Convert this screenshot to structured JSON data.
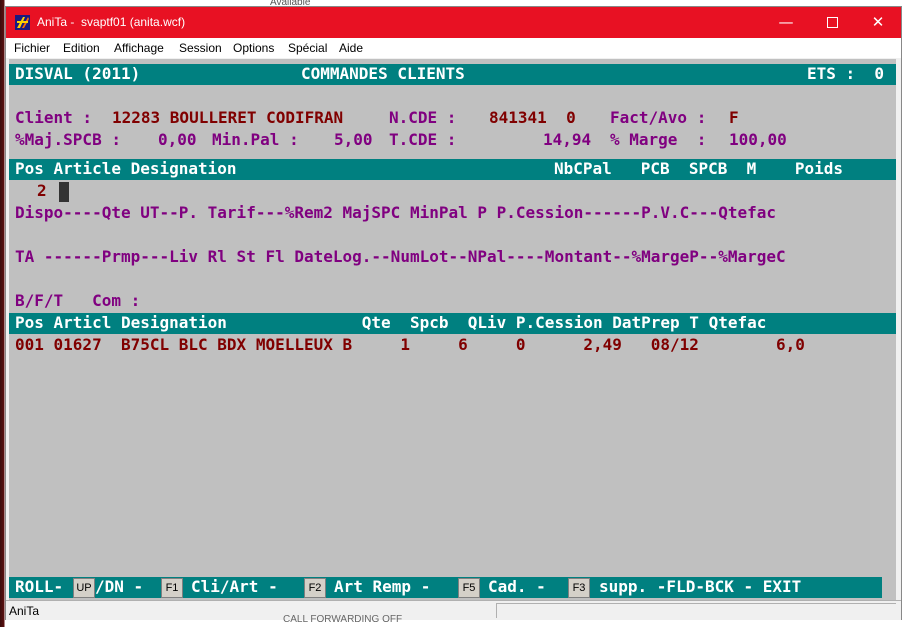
{
  "background": {
    "top_text": "Available",
    "bottom_text": "CALL FORWARDING OFF"
  },
  "window": {
    "title": "AniTa -  svaptf01 (anita.wcf)",
    "titlebar_color": "#e81123",
    "menu": [
      "Fichier",
      "Edition",
      "Affichage",
      "Session",
      "Options",
      "Spécial",
      "Aide"
    ],
    "status": "AniTa"
  },
  "terminal": {
    "colors": {
      "background": "#c0c0c0",
      "band": "#008080",
      "label": "#800080",
      "value": "#800000",
      "band_text": "#ffffff"
    },
    "header": {
      "left": "DISVAL (2011)",
      "center": "COMMANDES CLIENTS",
      "right": "ETS :  0"
    },
    "client": {
      "label": "Client :",
      "value": "12283 BOULLERET CODIFRAN",
      "ncde_label": "N.CDE :",
      "ncde_value": "841341  0",
      "fact_label": "Fact/Avo :",
      "fact_value": "F"
    },
    "line2": {
      "majspcb_label": "%Maj.SPCB :",
      "majspcb_value": "0,00",
      "minpal_label": "Min.Pal :",
      "minpal_value": "5,00",
      "tcde_label": "T.CDE :",
      "tcde_value": "14,94",
      "marge_label": "% Marge  :",
      "marge_value": "100,00"
    },
    "article_header": {
      "left": "Pos Article Designation",
      "right": "NbCPal   PCB  SPCB  M    Poids"
    },
    "pos_value": "2",
    "row_dispo": "Dispo----Qte UT--P. Tarif---%Rem2 MajSPC MinPal P P.Cession------P.V.C---Qtefac",
    "row_ta": "TA ------Prmp---Liv Rl St Fl DateLog.--NumLot--NPal----Montant--%MargeP--%MargeC",
    "row_bft": "B/F/T   Com :",
    "table_header": "Pos Articl Designation              Qte  Spcb  QLiv P.Cession DatPrep T Qtefac",
    "rows": [
      "001 01627  B75CL BLC BDX MOELLEUX B     1     6     0      2,49   08/12        6,0"
    ],
    "footer": {
      "roll": "ROLL-",
      "up_key": "UP",
      "dn": "/DN -",
      "f1_key": "F1",
      "f1_label": "Cli/Art -",
      "f2_key": "F2",
      "f2_label": "Art Remp -",
      "f5_key": "F5",
      "f5_label": "Cad. -",
      "f3_key": "F3",
      "f3_label": "supp. -FLD-BCK - EXIT"
    }
  }
}
